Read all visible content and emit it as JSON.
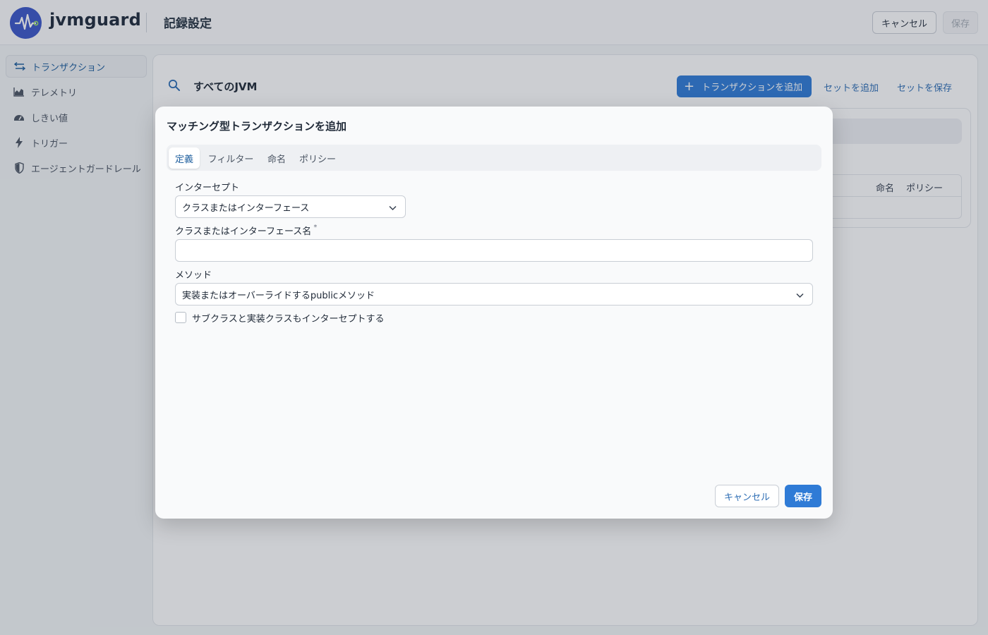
{
  "header": {
    "brand": "jvmguard",
    "title": "記録設定",
    "cancel_label": "キャンセル",
    "save_label": "保存"
  },
  "sidebar": {
    "items": [
      {
        "label": "トランザクション",
        "icon": "transactions-icon",
        "active": true
      },
      {
        "label": "テレメトリ",
        "icon": "telemetry-chart-icon",
        "active": false
      },
      {
        "label": "しきい値",
        "icon": "gauge-icon",
        "active": false
      },
      {
        "label": "トリガー",
        "icon": "lightning-icon",
        "active": false
      },
      {
        "label": "エージェントガードレール",
        "icon": "shield-icon",
        "active": false
      }
    ]
  },
  "main": {
    "scope_title": "すべてのJVM",
    "add_transaction_label": "トランザクションを追加",
    "add_set_label": "セットを追加",
    "save_set_label": "セットを保存",
    "table_columns": [
      "命名",
      "ポリシー"
    ]
  },
  "modal": {
    "title": "マッチング型トランザクションを追加",
    "tabs": [
      "定義",
      "フィルター",
      "命名",
      "ポリシー"
    ],
    "active_tab": "定義",
    "intercept_label": "インターセプト",
    "intercept_value": "クラスまたはインターフェース",
    "class_name_label": "クラスまたはインターフェース名",
    "required_mark": "*",
    "class_name_value": "",
    "method_label": "メソッド",
    "method_value": "実装またはオーバーライドするpublicメソッド",
    "subclass_checkbox_label": "サブクラスと実装クラスもインターセプトする",
    "subclass_checked": false,
    "cancel_label": "キャンセル",
    "save_label": "保存"
  },
  "colors": {
    "primary": "#2f7bd6",
    "brand": "#3b56c8",
    "link": "#2d6db4"
  }
}
